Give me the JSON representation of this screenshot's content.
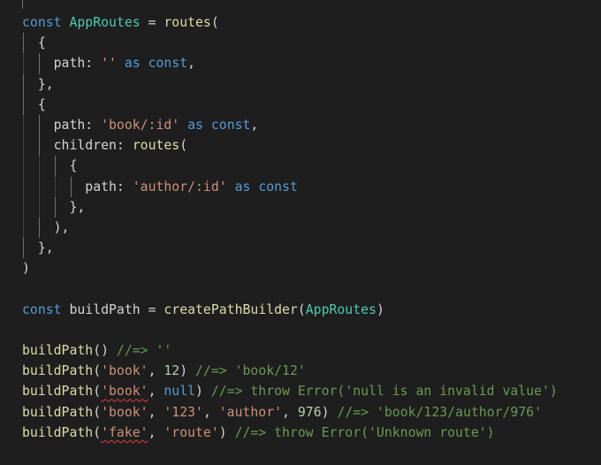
{
  "editor": {
    "language": "typescript",
    "theme": {
      "background": "#1e1e1e",
      "keyword": "#569cd6",
      "type": "#4ec9b0",
      "function": "#dcdcaa",
      "string": "#ce9178",
      "number": "#b5cea8",
      "comment": "#6a9955",
      "error_squiggle": "#e03b3b"
    },
    "lines": [
      {
        "indent": 0,
        "tokens": [
          {
            "t": "kw",
            "v": "const"
          },
          {
            "t": "pun",
            "v": " "
          },
          {
            "t": "cls",
            "v": "AppRoutes"
          },
          {
            "t": "pun",
            "v": " = "
          },
          {
            "t": "fn",
            "v": "routes"
          },
          {
            "t": "pun",
            "v": "("
          }
        ]
      },
      {
        "indent": 1,
        "tokens": [
          {
            "t": "pun",
            "v": "{"
          }
        ]
      },
      {
        "indent": 2,
        "tokens": [
          {
            "t": "prop",
            "v": "path"
          },
          {
            "t": "pun",
            "v": ": "
          },
          {
            "t": "str",
            "v": "''"
          },
          {
            "t": "pun",
            "v": " "
          },
          {
            "t": "kw",
            "v": "as"
          },
          {
            "t": "pun",
            "v": " "
          },
          {
            "t": "kw",
            "v": "const"
          },
          {
            "t": "pun",
            "v": ","
          }
        ]
      },
      {
        "indent": 1,
        "tokens": [
          {
            "t": "pun",
            "v": "},"
          }
        ]
      },
      {
        "indent": 1,
        "tokens": [
          {
            "t": "pun",
            "v": "{"
          }
        ]
      },
      {
        "indent": 2,
        "tokens": [
          {
            "t": "prop",
            "v": "path"
          },
          {
            "t": "pun",
            "v": ": "
          },
          {
            "t": "str",
            "v": "'book/:id'"
          },
          {
            "t": "pun",
            "v": " "
          },
          {
            "t": "kw",
            "v": "as"
          },
          {
            "t": "pun",
            "v": " "
          },
          {
            "t": "kw",
            "v": "const"
          },
          {
            "t": "pun",
            "v": ","
          }
        ]
      },
      {
        "indent": 2,
        "tokens": [
          {
            "t": "prop",
            "v": "children"
          },
          {
            "t": "pun",
            "v": ": "
          },
          {
            "t": "fn",
            "v": "routes"
          },
          {
            "t": "pun",
            "v": "("
          }
        ]
      },
      {
        "indent": 3,
        "tokens": [
          {
            "t": "pun",
            "v": "{"
          }
        ]
      },
      {
        "indent": 4,
        "tokens": [
          {
            "t": "prop",
            "v": "path"
          },
          {
            "t": "pun",
            "v": ": "
          },
          {
            "t": "str",
            "v": "'author/:id'"
          },
          {
            "t": "pun",
            "v": " "
          },
          {
            "t": "kw",
            "v": "as"
          },
          {
            "t": "pun",
            "v": " "
          },
          {
            "t": "kw",
            "v": "const"
          }
        ]
      },
      {
        "indent": 3,
        "tokens": [
          {
            "t": "pun",
            "v": "},"
          }
        ]
      },
      {
        "indent": 2,
        "tokens": [
          {
            "t": "pun",
            "v": "),"
          }
        ]
      },
      {
        "indent": 1,
        "tokens": [
          {
            "t": "pun",
            "v": "},"
          }
        ]
      },
      {
        "indent": 0,
        "tokens": [
          {
            "t": "pun",
            "v": ")"
          }
        ]
      },
      {
        "indent": 0,
        "tokens": []
      },
      {
        "indent": 0,
        "tokens": [
          {
            "t": "kw",
            "v": "const"
          },
          {
            "t": "pun",
            "v": " "
          },
          {
            "t": "prop",
            "v": "buildPath"
          },
          {
            "t": "pun",
            "v": " = "
          },
          {
            "t": "fn",
            "v": "createPathBuilder"
          },
          {
            "t": "pun",
            "v": "("
          },
          {
            "t": "cls",
            "v": "AppRoutes"
          },
          {
            "t": "pun",
            "v": ")"
          }
        ]
      },
      {
        "indent": 0,
        "tokens": []
      },
      {
        "indent": 0,
        "tokens": [
          {
            "t": "fn",
            "v": "buildPath"
          },
          {
            "t": "pun",
            "v": "() "
          },
          {
            "t": "cmt",
            "v": "//=> ''"
          }
        ]
      },
      {
        "indent": 0,
        "tokens": [
          {
            "t": "fn",
            "v": "buildPath"
          },
          {
            "t": "pun",
            "v": "("
          },
          {
            "t": "str",
            "v": "'book'"
          },
          {
            "t": "pun",
            "v": ", "
          },
          {
            "t": "num",
            "v": "12"
          },
          {
            "t": "pun",
            "v": ") "
          },
          {
            "t": "cmt",
            "v": "//=> 'book/12'"
          }
        ]
      },
      {
        "indent": 0,
        "tokens": [
          {
            "t": "fn",
            "v": "buildPath"
          },
          {
            "t": "pun",
            "v": "("
          },
          {
            "t": "str",
            "v": "'book'",
            "err": true
          },
          {
            "t": "pun",
            "v": ", "
          },
          {
            "t": "kw",
            "v": "null"
          },
          {
            "t": "pun",
            "v": ") "
          },
          {
            "t": "cmt",
            "v": "//=> throw Error('null is an invalid value')"
          }
        ]
      },
      {
        "indent": 0,
        "tokens": [
          {
            "t": "fn",
            "v": "buildPath"
          },
          {
            "t": "pun",
            "v": "("
          },
          {
            "t": "str",
            "v": "'book'"
          },
          {
            "t": "pun",
            "v": ", "
          },
          {
            "t": "str",
            "v": "'123'"
          },
          {
            "t": "pun",
            "v": ", "
          },
          {
            "t": "str",
            "v": "'author'"
          },
          {
            "t": "pun",
            "v": ", "
          },
          {
            "t": "num",
            "v": "976"
          },
          {
            "t": "pun",
            "v": ") "
          },
          {
            "t": "cmt",
            "v": "//=> 'book/123/author/976'"
          }
        ]
      },
      {
        "indent": 0,
        "tokens": [
          {
            "t": "fn",
            "v": "buildPath"
          },
          {
            "t": "pun",
            "v": "("
          },
          {
            "t": "str",
            "v": "'fake'",
            "err": true
          },
          {
            "t": "pun",
            "v": ", "
          },
          {
            "t": "str",
            "v": "'route'"
          },
          {
            "t": "pun",
            "v": ") "
          },
          {
            "t": "cmt",
            "v": "//=> throw Error('Unknown route')"
          }
        ]
      }
    ]
  }
}
